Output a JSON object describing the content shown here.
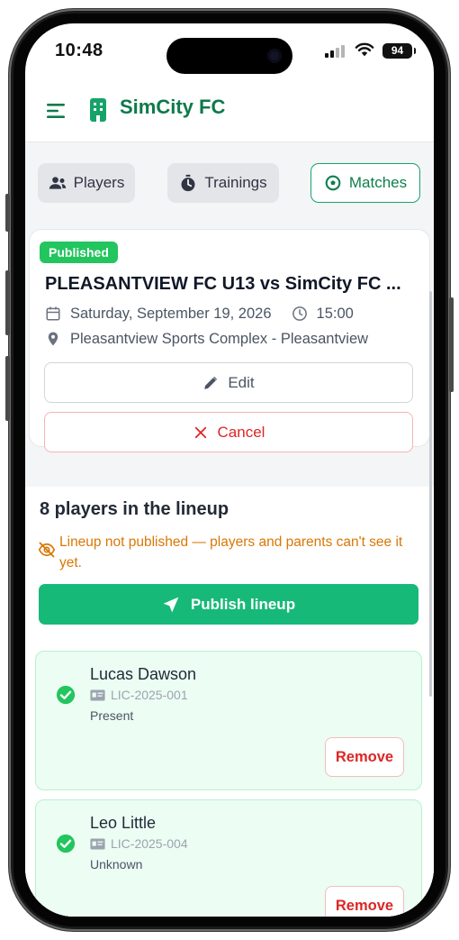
{
  "status_bar": {
    "time": "10:48",
    "battery": "94"
  },
  "header": {
    "title": "SimCity FC"
  },
  "tabs": [
    {
      "label": "Players",
      "active": false
    },
    {
      "label": "Trainings",
      "active": false
    },
    {
      "label": "Matches",
      "active": true
    }
  ],
  "match": {
    "status_badge": "Published",
    "title": "PLEASANTVIEW FC U13 vs SimCity FC ...",
    "date": "Saturday, September 19, 2026",
    "time": "15:00",
    "location": "Pleasantview Sports Complex - Pleasantview",
    "edit_label": "Edit",
    "cancel_label": "Cancel"
  },
  "lineup": {
    "title": "8 players in the lineup",
    "warning": "Lineup not published — players and parents can't see it yet.",
    "publish_label": "Publish lineup",
    "players": [
      {
        "name": "Lucas Dawson",
        "license": "LIC-2025-001",
        "status": "Present",
        "remove_label": "Remove"
      },
      {
        "name": "Leo Little",
        "license": "LIC-2025-004",
        "status": "Unknown",
        "remove_label": "Remove"
      }
    ]
  },
  "colors": {
    "brand": "#0d7a4a",
    "published_badge": "#22c55e",
    "publish_button": "#17b978",
    "danger": "#dc2626",
    "warning": "#d97706"
  }
}
